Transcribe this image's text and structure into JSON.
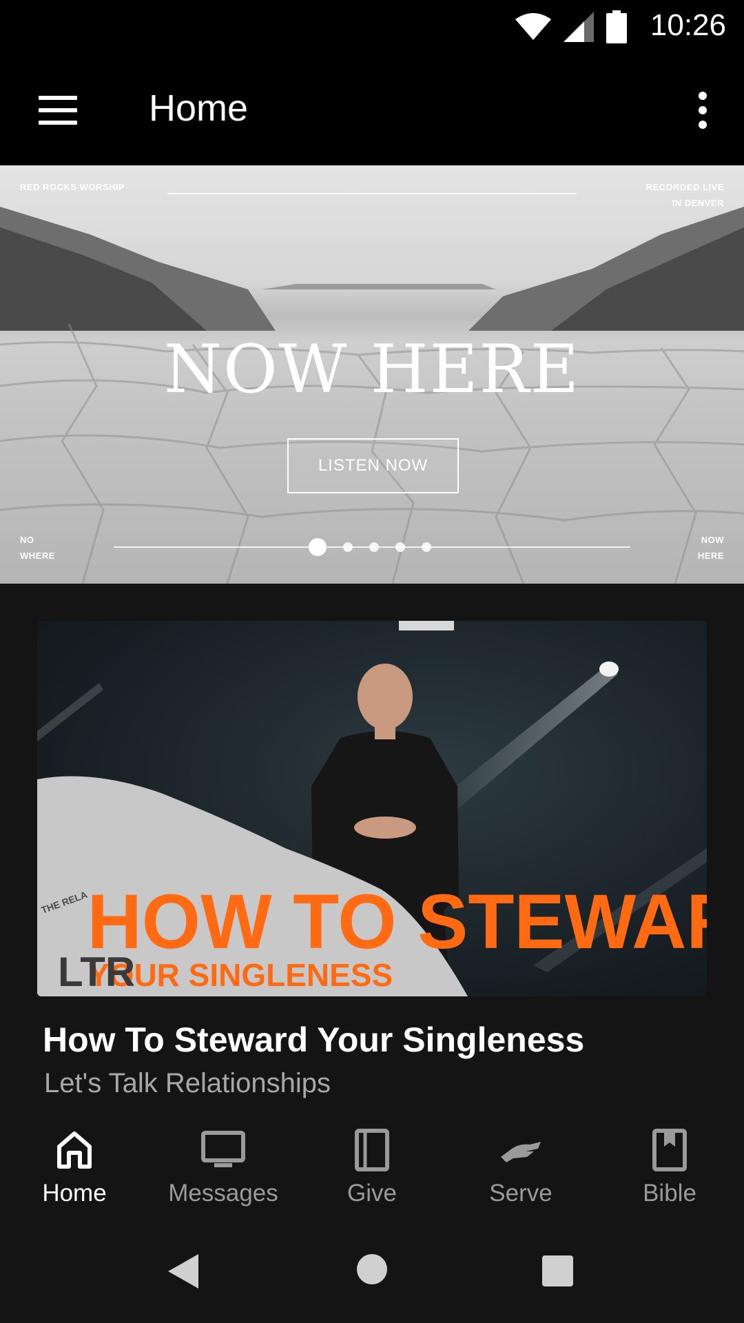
{
  "status_bar": {
    "time": "10:26",
    "icons": [
      "wifi-icon",
      "signal-icon",
      "battery-icon"
    ]
  },
  "app_bar": {
    "title": "Home",
    "menu_icon": "menu-icon",
    "more_icon": "more-vert-icon"
  },
  "hero": {
    "top_left": "RED ROCKS WORSHIP",
    "top_right": "RECORDED LIVE IN DENVER",
    "title": "NOW HERE",
    "button_label": "LISTEN NOW",
    "bottom_left": "NO WHERE",
    "bottom_right": "NOW HERE",
    "carousel_count": 5,
    "carousel_active": 1
  },
  "featured": {
    "artwork_line1": "HOW TO STEWARD",
    "artwork_line2": "YOUR SINGLENESS",
    "artwork_badge": "THE RELA",
    "title": "How To Steward Your Singleness",
    "series": "Let's Talk Relationships",
    "accent_color": "#ff6a13"
  },
  "bottom_nav": {
    "items": [
      {
        "label": "Home",
        "icon": "home-icon",
        "active": true
      },
      {
        "label": "Messages",
        "icon": "tv-icon",
        "active": false
      },
      {
        "label": "Give",
        "icon": "give-icon",
        "active": false
      },
      {
        "label": "Serve",
        "icon": "serve-hand-icon",
        "active": false
      },
      {
        "label": "Bible",
        "icon": "bible-bookmark-icon",
        "active": false
      }
    ]
  }
}
